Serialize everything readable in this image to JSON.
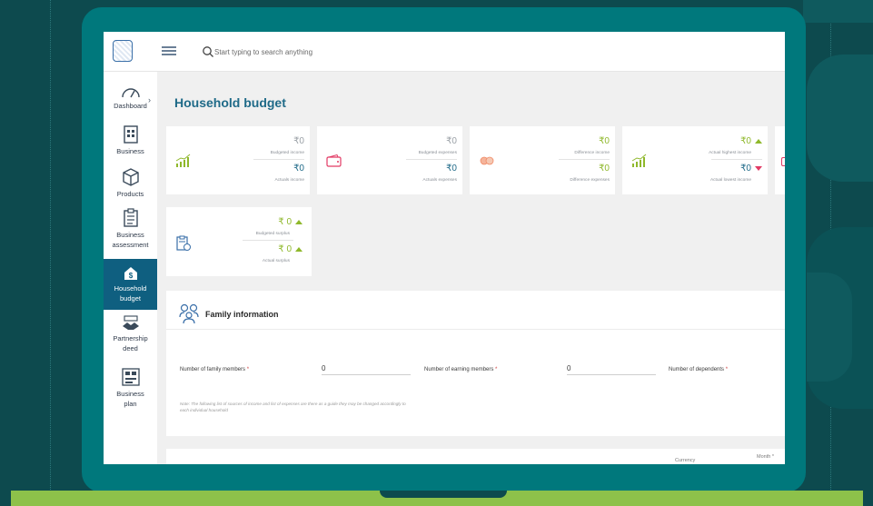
{
  "topbar": {
    "search_placeholder": "Start typing to search anything"
  },
  "sidebar": {
    "items": [
      {
        "label": "Dashboard"
      },
      {
        "label": "Business"
      },
      {
        "label": "Products"
      },
      {
        "label": "Business assessment"
      },
      {
        "label": "Household budget",
        "active": true
      },
      {
        "label": "Partnership deed"
      },
      {
        "label": "Business plan"
      }
    ]
  },
  "page": {
    "title": "Household budget"
  },
  "cards": {
    "income": {
      "top_value": "₹0",
      "top_label": "Budgeted income",
      "bottom_value": "₹0",
      "bottom_label": "Actuals income"
    },
    "expenses": {
      "top_value": "₹0",
      "top_label": "Budgeted expenses",
      "bottom_value": "₹0",
      "bottom_label": "Actuals expenses"
    },
    "difference": {
      "top_value": "₹0",
      "top_label": "Difference income",
      "bottom_value": "₹0",
      "bottom_label": "Difference expenses"
    },
    "highest_lowest": {
      "top_value": "₹0",
      "top_label": "Actual highest income",
      "bottom_value": "₹0",
      "bottom_label": "Actual lowest income"
    },
    "surplus": {
      "top_value": "₹ 0",
      "top_label": "Budgeted surplus",
      "bottom_value": "₹ 0",
      "bottom_label": "Actual surplus"
    }
  },
  "family": {
    "title": "Family information",
    "family_members_label": "Number of family members",
    "family_members_value": "0",
    "earning_members_label": "Number of earning members",
    "earning_members_value": "0",
    "dependents_label": "Number of dependents",
    "required_mark": "*",
    "note": "Note: The following list of sources of income and list of expenses are there as a guide they may be changed accordingly to each individual household"
  },
  "bottom": {
    "currency_label": "Currency",
    "month_label": "Month *"
  },
  "colors": {
    "brand_blue": "#1f6a88",
    "active_nav": "#0f5f80",
    "positive_green": "#8fb82b",
    "negative_red": "#e23a64",
    "laptop_teal": "#00787c"
  }
}
